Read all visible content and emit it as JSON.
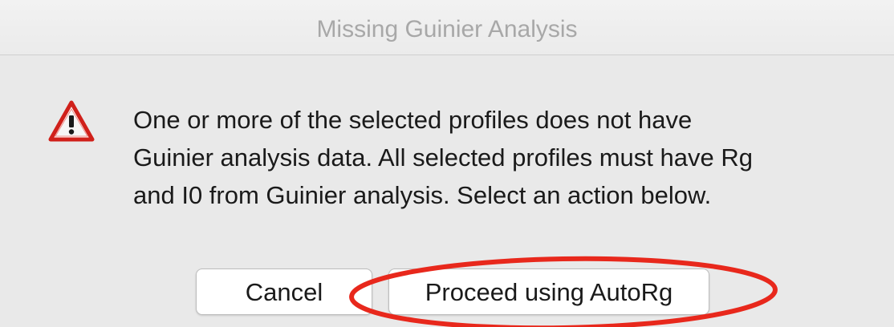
{
  "window": {
    "title": "Missing Guinier Analysis"
  },
  "alert": {
    "icon": "warning-triangle-icon",
    "icon_color": "#d0201a",
    "message_lines": [
      "One or more of the selected profiles does not have",
      "Guinier analysis data. All selected profiles must have Rg",
      "and I0 from Guinier analysis. Select an action below."
    ]
  },
  "buttons": {
    "cancel_label": "Cancel",
    "proceed_label": "Proceed using AutoRg"
  },
  "annotation": {
    "highlight_color": "#e8281c",
    "target": "Proceed using AutoRg"
  }
}
